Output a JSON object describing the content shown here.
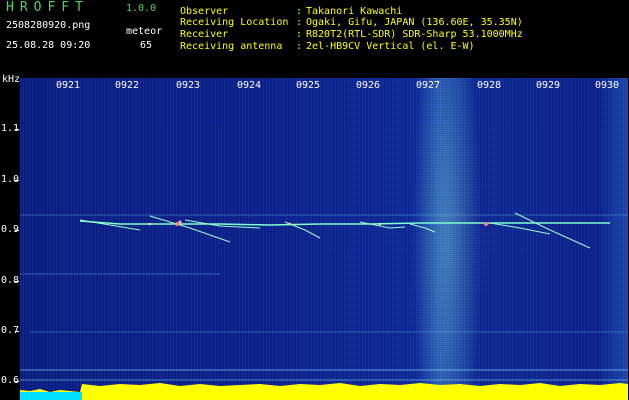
{
  "header": {
    "app_name": "HROFFT",
    "app_version": "1.0.0",
    "filename": "2508280920.png",
    "datetime": "25.08.28 09:20",
    "meteor_label": "meteor",
    "meteor_count": "65"
  },
  "info": [
    {
      "label": "Observer",
      "value": "Takanori Kawachi"
    },
    {
      "label": "Receiving Location",
      "value": "Ogaki, Gifu, JAPAN (136.60E, 35.35N)"
    },
    {
      "label": "Receiver",
      "value": "R820T2(RTL-SDR) SDR-Sharp 53.1000MHz"
    },
    {
      "label": "Receiving antenna",
      "value": "2el-HB9CV Vertical (el. E-W)"
    }
  ],
  "spectrogram": {
    "y_unit": "kHz",
    "y_ticks": [
      "1.1",
      "1.0",
      "0.9",
      "0.8",
      "0.7",
      "0.6"
    ],
    "x_ticks": [
      "0921",
      "0922",
      "0923",
      "0924",
      "0925",
      "0926",
      "0927",
      "0928",
      "0929",
      "0930"
    ],
    "background_color": "#0b2294",
    "trace_color": "#7fffd4",
    "baseline_color": "#ffff00",
    "bright_band_minute": "0927"
  }
}
